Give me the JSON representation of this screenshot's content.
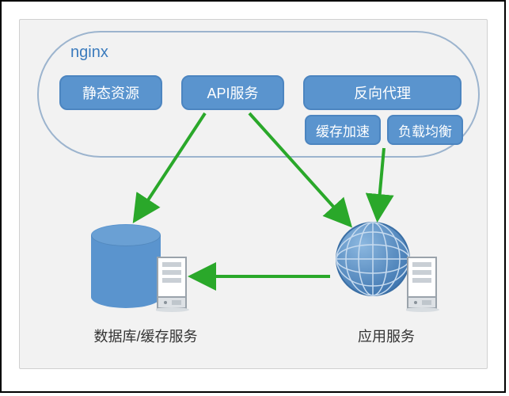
{
  "nginx": {
    "title": "nginx",
    "static_resources": "静态资源",
    "api_service": "API服务",
    "reverse_proxy": "反向代理",
    "cache_accel": "缓存加速",
    "load_balance": "负载均衡"
  },
  "nodes": {
    "db_cache_label": "数据库/缓存服务",
    "app_service_label": "应用服务"
  },
  "colors": {
    "pill_fill": "#5a94ce",
    "pill_border": "#4c85c0",
    "group_border": "#9cb4ce",
    "arrow": "#2aa82a",
    "panel_bg": "#f2f2f2"
  }
}
